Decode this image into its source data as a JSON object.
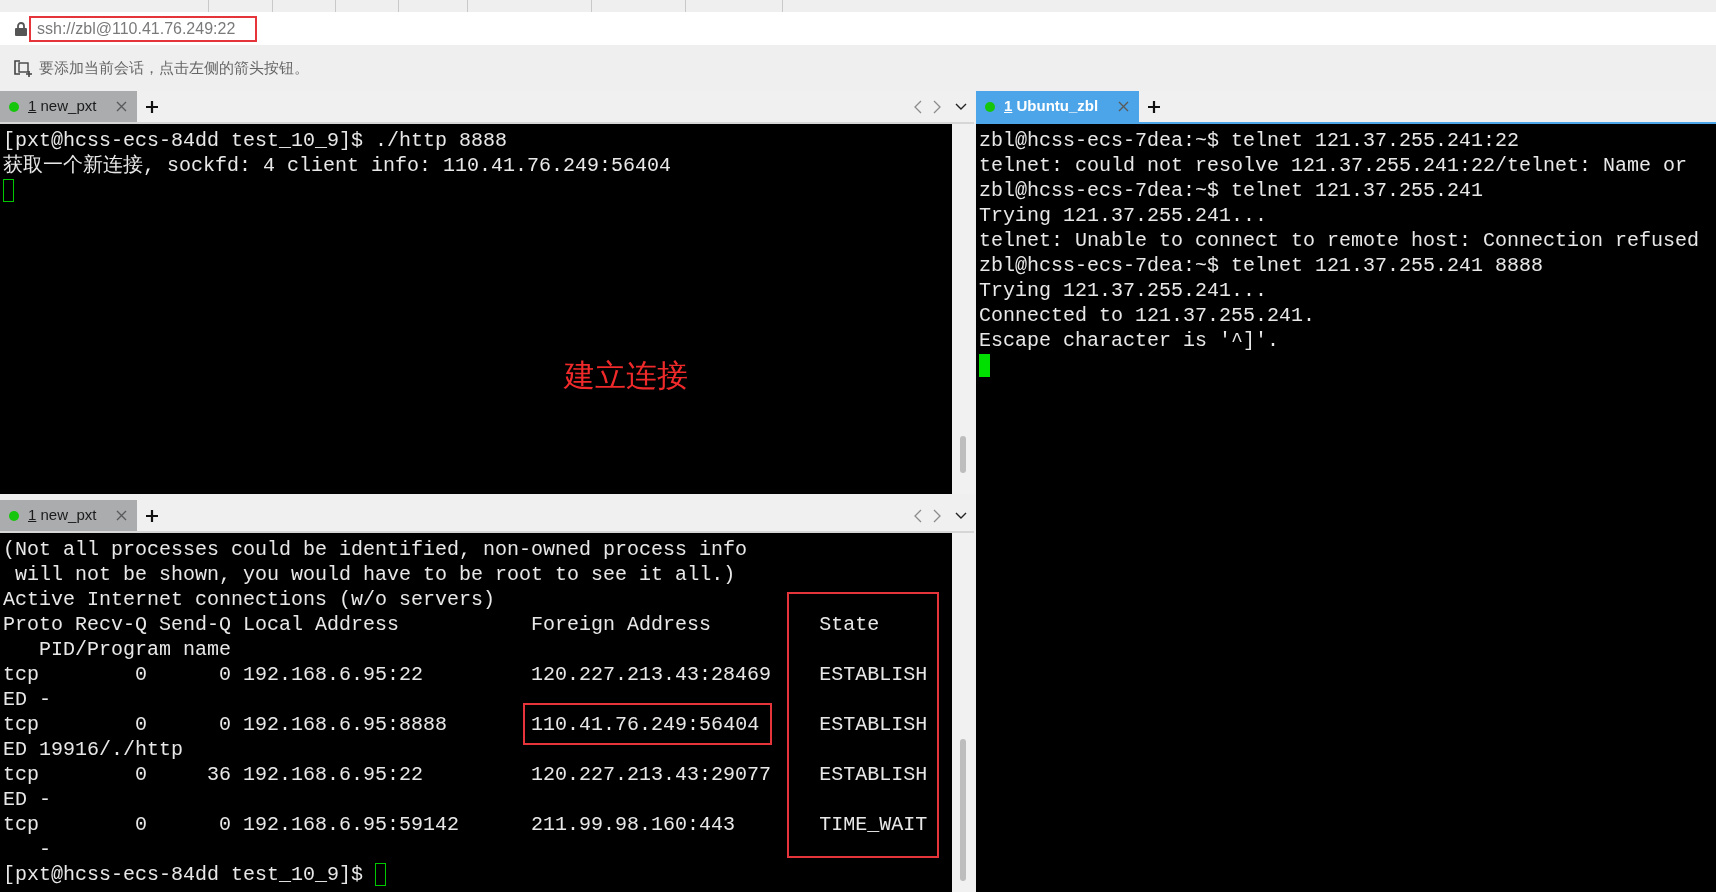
{
  "address_bar": {
    "url": "ssh://zbl@110.41.76.249:22",
    "framed": true
  },
  "hint": {
    "text": "要添加当前会话，点击左侧的箭头按钮。"
  },
  "left_column": {
    "panes": [
      {
        "tabs": [
          {
            "number": "1",
            "name": "new_pxt",
            "active": false
          }
        ],
        "tab_navigation": true,
        "scrollbar": true,
        "terminal": {
          "lines": [
            "[pxt@hcss-ecs-84dd test_10_9]$ ./http 8888",
            "获取一个新连接, sockfd: 4 client info: 110.41.76.249:56404",
            {
              "cursor": {
                "filled": false
              }
            }
          ],
          "annotations": [
            {
              "text": "建立连接"
            }
          ]
        }
      },
      {
        "tabs": [
          {
            "number": "1",
            "name": "new_pxt",
            "active": false
          }
        ],
        "tab_navigation": true,
        "scrollbar": true,
        "terminal": {
          "lines": [
            "(Not all processes could be identified, non-owned process info",
            " will not be shown, you would have to be root to see it all.)",
            "Active Internet connections (w/o servers)",
            {
              "segments": [
                {
                  "text": "Proto Recv-Q Send-Q Local Address           Foreign Address"
                },
                {
                  "text": "         State",
                  "column_boxed": true
                }
              ]
            },
            "   PID/Program name",
            {
              "segments": [
                {
                  "text": "tcp        0      0 192.168.6.95:22         120.227.213.43:28469"
                },
                {
                  "text": "    ESTABLISH",
                  "column_boxed": true
                }
              ]
            },
            "ED -",
            {
              "segments": [
                {
                  "text": "tcp        0      0 192.168.6.95:8888"
                },
                {
                  "text": "       110.41.76.249:56404",
                  "boxed": true
                },
                {
                  "text": "     ESTABLISH",
                  "column_boxed": true
                }
              ]
            },
            "ED 19916/./http",
            {
              "segments": [
                {
                  "text": "tcp        0     36 192.168.6.95:22         120.227.213.43:29077"
                },
                {
                  "text": "    ESTABLISH",
                  "column_boxed": true
                }
              ]
            },
            "ED -",
            {
              "segments": [
                {
                  "text": "tcp        0      0 192.168.6.95:59142      211.99.98.160:443"
                },
                {
                  "text": "       TIME_WAIT",
                  "column_boxed": true
                }
              ]
            },
            "   -",
            {
              "segments": [
                {
                  "text": "[pxt@hcss-ecs-84dd test_10_9]$"
                }
              ],
              "cursor": {
                "filled": false
              }
            }
          ]
        }
      }
    ]
  },
  "right_column": {
    "panes": [
      {
        "tabs": [
          {
            "number": "1",
            "name": "Ubuntu_zbl",
            "active": true
          }
        ],
        "tab_navigation": false,
        "scrollbar": false,
        "terminal": {
          "lines": [
            "zbl@hcss-ecs-7dea:~$ telnet 121.37.255.241:22",
            "telnet: could not resolve 121.37.255.241:22/telnet: Name or",
            "zbl@hcss-ecs-7dea:~$ telnet 121.37.255.241",
            "Trying 121.37.255.241...",
            "telnet: Unable to connect to remote host: Connection refused",
            "zbl@hcss-ecs-7dea:~$ telnet 121.37.255.241 8888",
            "Trying 121.37.255.241...",
            "Connected to 121.37.255.241.",
            "Escape character is '^]'.",
            {
              "cursor": {
                "filled": true
              }
            }
          ]
        }
      }
    ]
  }
}
